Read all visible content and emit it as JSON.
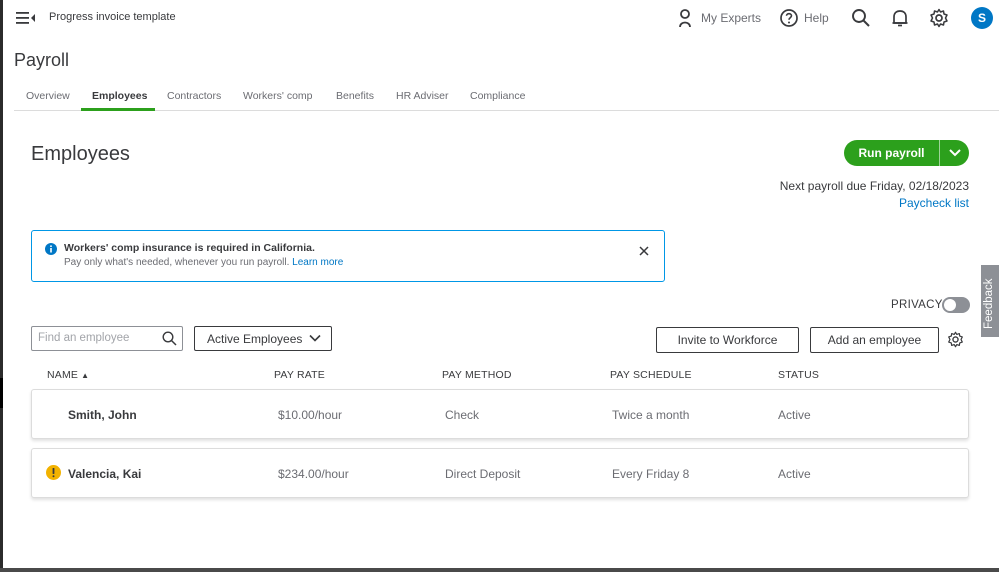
{
  "topbar": {
    "title": "Progress invoice template",
    "my_experts": "My Experts",
    "help": "Help",
    "avatar_initial": "S"
  },
  "page": {
    "title": "Payroll"
  },
  "tabs": [
    {
      "label": "Overview"
    },
    {
      "label": "Employees"
    },
    {
      "label": "Contractors"
    },
    {
      "label": "Workers' comp"
    },
    {
      "label": "Benefits"
    },
    {
      "label": "HR Adviser"
    },
    {
      "label": "Compliance"
    }
  ],
  "active_tab": "Employees",
  "section": {
    "title": "Employees",
    "run_payroll": "Run payroll",
    "next_payroll": "Next payroll due Friday, 02/18/2023",
    "paycheck_list": "Paycheck list"
  },
  "alert": {
    "title": "Workers' comp insurance is required in California.",
    "body": "Pay only what's needed, whenever you run payroll.",
    "link": "Learn more"
  },
  "privacy": {
    "label": "PRIVACY",
    "enabled": false
  },
  "feedback": "Feedback",
  "filters": {
    "search_placeholder": "Find an employee",
    "status_filter": "Active Employees",
    "invite_button": "Invite to Workforce",
    "add_button": "Add an employee"
  },
  "table": {
    "columns": {
      "name": "NAME",
      "pay_rate": "PAY RATE",
      "pay_method": "PAY METHOD",
      "pay_schedule": "PAY SCHEDULE",
      "status": "STATUS"
    },
    "sort_indicator": "▲",
    "rows": [
      {
        "name": "Smith, John",
        "pay_rate": "$10.00/hour",
        "pay_method": "Check",
        "pay_schedule": "Twice a month",
        "status": "Active",
        "warning": false
      },
      {
        "name": "Valencia, Kai",
        "pay_rate": "$234.00/hour",
        "pay_method": "Direct Deposit",
        "pay_schedule": "Every Friday 8",
        "status": "Active",
        "warning": true
      }
    ]
  },
  "colors": {
    "brand_green": "#2ca01c",
    "link_blue": "#0077c5",
    "info_blue": "#0097e6",
    "warning_amber": "#f2b200"
  }
}
